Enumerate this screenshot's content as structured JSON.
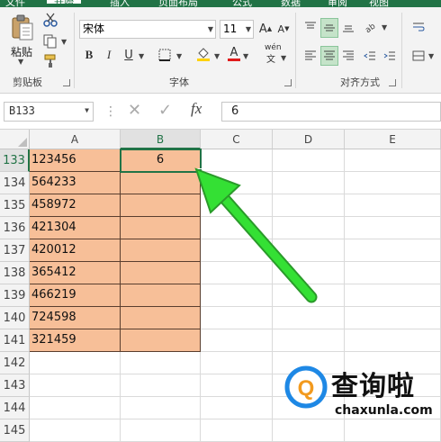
{
  "ribbon": {
    "tabs": [
      "文件",
      "开始",
      "插入",
      "页面布局",
      "公式",
      "数据",
      "审阅",
      "视图"
    ],
    "clipboard": {
      "paste_label": "粘贴",
      "group_label": "剪贴板"
    },
    "font": {
      "name": "宋体",
      "size": "11",
      "group_label": "字体",
      "pinyin": "wén"
    },
    "alignment": {
      "group_label": "对齐方式"
    }
  },
  "formula_bar": {
    "name_box": "B133",
    "value": "6"
  },
  "columns": [
    "A",
    "B",
    "C",
    "D",
    "E"
  ],
  "rows": [
    {
      "num": "133",
      "a": "123456",
      "b": "6"
    },
    {
      "num": "134",
      "a": "564233",
      "b": ""
    },
    {
      "num": "135",
      "a": "458972",
      "b": ""
    },
    {
      "num": "136",
      "a": "421304",
      "b": ""
    },
    {
      "num": "137",
      "a": "420012",
      "b": ""
    },
    {
      "num": "138",
      "a": "365412",
      "b": ""
    },
    {
      "num": "139",
      "a": "466219",
      "b": ""
    },
    {
      "num": "140",
      "a": "724598",
      "b": ""
    },
    {
      "num": "141",
      "a": "321459",
      "b": ""
    },
    {
      "num": "142",
      "a": "",
      "b": ""
    },
    {
      "num": "143",
      "a": "",
      "b": ""
    },
    {
      "num": "144",
      "a": "",
      "b": ""
    },
    {
      "num": "145",
      "a": "",
      "b": ""
    }
  ],
  "watermark": {
    "title": "查询啦",
    "domain": "chaxunla.com"
  },
  "colors": {
    "fill": "#f7bf98",
    "excel_green": "#217346",
    "arrow": "#2ed12e"
  }
}
